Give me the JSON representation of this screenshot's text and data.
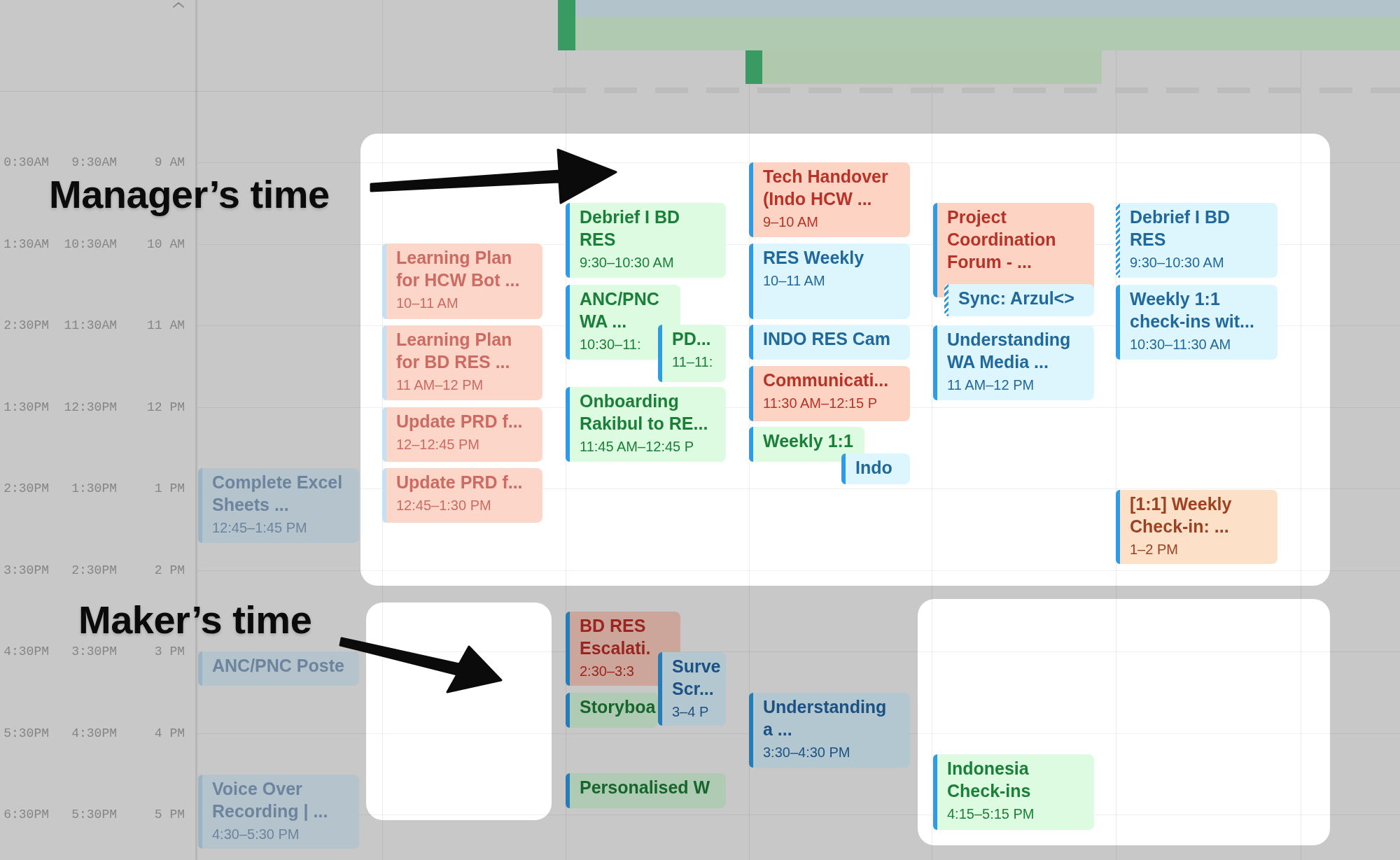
{
  "time_axis": {
    "zones": [
      {
        "labels": [
          "0:30AM",
          "1:30AM",
          "2:30PM",
          "1:30PM",
          "2:30PM",
          "3:30PM",
          "4:30PM",
          "5:30PM",
          "6:30PM"
        ]
      },
      {
        "labels": [
          "9:30AM",
          "10:30AM",
          "11:30AM",
          "12:30PM",
          "1:30PM",
          "2:30PM",
          "3:30PM",
          "4:30PM",
          "5:30PM"
        ]
      },
      {
        "labels": [
          "9 AM",
          "10 AM",
          "11 AM",
          "12 PM",
          "1 PM",
          "2 PM",
          "3 PM",
          "4 PM",
          "5 PM"
        ]
      }
    ]
  },
  "days": [
    {
      "events": [
        {
          "title": "Complete Excel Sheets ...",
          "time": "12:45–1:45 PM",
          "color": "#b5c4cc",
          "faded": true,
          "tentative": false
        },
        {
          "title": "ANC/PNC Poste",
          "color": "#b5c4cc",
          "faded": true,
          "tentative": false
        },
        {
          "title": "Voice Over Recording | ...",
          "time": "4:30–5:30 PM",
          "color": "#b5c4cc",
          "faded": true,
          "tentative": false
        }
      ]
    },
    {
      "events": [
        {
          "title": "Learning Plan for HCW Bot ...",
          "time": "10–11 AM",
          "color": "#fcd6c8",
          "faded": true,
          "tentative": false
        },
        {
          "title": "Learning Plan for BD RES ...",
          "time": "11 AM–12 PM",
          "color": "#fcd6c8",
          "faded": true,
          "tentative": false
        },
        {
          "title": "Update PRD f...",
          "time": "12–12:45 PM",
          "color": "#fcd6c8",
          "faded": true,
          "tentative": false
        },
        {
          "title": "Update PRD f...",
          "time": "12:45–1:30 PM",
          "color": "#fcd6c8",
          "faded": true,
          "tentative": false
        }
      ]
    },
    {
      "events": [
        {
          "title": "Debrief I BD RES",
          "time": "9:30–10:30 AM",
          "color": "#dcfbe0",
          "faded": false,
          "tentative": false
        },
        {
          "title": "ANC/PNC WA ...",
          "time": "10:30–11:",
          "color": "#dcfbe0",
          "faded": false,
          "tentative": false
        },
        {
          "title": "PD...",
          "time": "11–11:",
          "color": "#dcfbe0",
          "faded": false,
          "tentative": false
        },
        {
          "title": "Onboarding Rakibul to RE...",
          "time": "11:45 AM–12:45 P",
          "color": "#dcfbe0",
          "faded": false,
          "tentative": false
        },
        {
          "title": "BD RES Escalati.",
          "time": "2:30–3:3",
          "color": "#cca69a",
          "faded": false,
          "tentative": false
        },
        {
          "title": "Storyboa",
          "color": "#b0cbb3",
          "faded": false,
          "tentative": false
        },
        {
          "title": "Surve Scr...",
          "time": "3–4 P",
          "color": "#b3c7d0",
          "faded": false,
          "tentative": false
        },
        {
          "title": "Personalised W",
          "color": "#b0cbb3",
          "faded": false,
          "tentative": false
        }
      ]
    },
    {
      "events": [
        {
          "title": "Tech Handover (Indo HCW ...",
          "time": "9–10 AM",
          "color": "#fdd4c4",
          "faded": false,
          "tentative": false
        },
        {
          "title": "RES Weekly",
          "time": "10–11 AM",
          "color": "#ddf5fd",
          "faded": false,
          "tentative": false
        },
        {
          "title": "INDO RES Cam",
          "color": "#ddf5fd",
          "faded": false,
          "tentative": false
        },
        {
          "title": "Communicati...",
          "time": "11:30 AM–12:15 P",
          "color": "#fdd4c4",
          "faded": false,
          "tentative": false
        },
        {
          "title": "Weekly 1:1",
          "color": "#dcfbe0",
          "faded": false,
          "tentative": false
        },
        {
          "title": "Indo",
          "color": "#ddf5fd",
          "faded": false,
          "tentative": false
        },
        {
          "title": "Understanding a ...",
          "time": "3:30–4:30 PM",
          "color": "#b3c7d0",
          "faded": false,
          "tentative": false
        }
      ]
    },
    {
      "events": [
        {
          "title": "Project Coordination Forum - ...",
          "color": "#fdd4c4",
          "faded": false,
          "tentative": false
        },
        {
          "title": "Sync: Arzul<>",
          "color": "#ddf5fd",
          "faded": false,
          "tentative": true
        },
        {
          "title": "Understanding WA Media ...",
          "time": "11 AM–12 PM",
          "color": "#ddf5fd",
          "faded": false,
          "tentative": false
        },
        {
          "title": "Indonesia Check-ins",
          "time": "4:15–5:15 PM",
          "color": "#dcfbe0",
          "faded": false,
          "tentative": false
        }
      ]
    },
    {
      "events": [
        {
          "title": "Debrief I BD RES",
          "time": "9:30–10:30 AM",
          "color": "#ddf5fd",
          "faded": false,
          "tentative": true
        },
        {
          "title": "Weekly 1:1 check-ins wit...",
          "time": "10:30–11:30 AM",
          "color": "#ddf5fd",
          "faded": false,
          "tentative": false
        },
        {
          "title": "[1:1] Weekly Check-in: ...",
          "time": "1–2 PM",
          "color": "#fde0c8",
          "faded": false,
          "tentative": false
        }
      ]
    }
  ],
  "annotations": [
    {
      "text": "Manager’s time"
    },
    {
      "text": "Maker’s time"
    }
  ]
}
